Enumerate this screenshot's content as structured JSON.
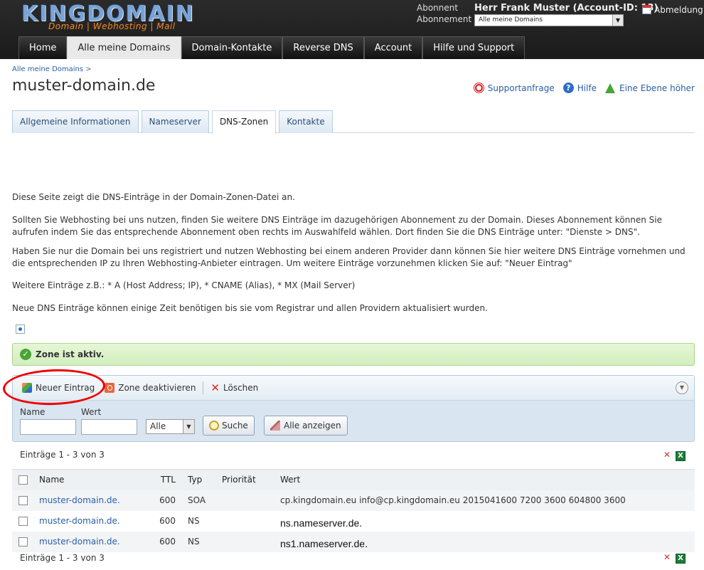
{
  "header": {
    "logo_text": "KINGDOMAIN",
    "logo_tagline": "Domain | Webhosting | Mail",
    "label_abonnent": "Abonnent",
    "label_abonnement": "Abonnement",
    "user": "Herr Frank Muster (Account-ID: 13)",
    "abonnement_selected": "Alle meine Domains",
    "logout": "Abmeldung"
  },
  "nav": [
    "Home",
    "Alle meine Domains",
    "Domain-Kontakte",
    "Reverse DNS",
    "Account",
    "Hilfe und Support"
  ],
  "breadcrumb": {
    "item": "Alle meine Domains",
    "sep": ">"
  },
  "page_title": "muster-domain.de",
  "top_actions": {
    "support": "Supportanfrage",
    "help": "Hilfe",
    "up": "Eine Ebene höher"
  },
  "tabs": [
    "Allgemeine Informationen",
    "Nameserver",
    "DNS-Zonen",
    "Kontakte"
  ],
  "paragraphs": [
    "Diese Seite zeigt die DNS-Einträge in der Domain-Zonen-Datei an.",
    "Sollten Sie Webhosting bei uns nutzen, finden Sie weitere DNS Einträge im dazugehörigen Abonnement zu der Domain. Dieses Abonnement können Sie aufrufen indem Sie das entsprechende Abonnement oben rechts im Auswahlfeld wählen. Dort finden Sie die DNS Einträge unter: \"Dienste > DNS\".",
    "Haben Sie nur die Domain bei uns registriert und nutzen Webhosting bei einem anderen Provider dann können Sie hier weitere DNS Einträge vornehmen und die entsprechenden IP zu Ihren Webhosting-Anbieter eintragen. Um weitere Einträge vorzunehmen klicken Sie auf: \"Neuer Eintrag\"",
    "Weitere Einträge z.B.: * A (Host Address; IP), * CNAME (Alias), * MX (Mail Server)",
    "Neue DNS Einträge können einige Zeit benötigen bis sie vom Registrar und allen Providern aktualisiert wurden."
  ],
  "status": "Zone ist aktiv.",
  "toolbar": {
    "new": "Neuer Eintrag",
    "deactivate": "Zone deaktivieren",
    "delete": "Löschen"
  },
  "filter": {
    "name_label": "Name",
    "wert_label": "Wert",
    "type_selected": "Alle",
    "search": "Suche",
    "show_all": "Alle anzeigen"
  },
  "count_text": "Einträge 1 - 3 von 3",
  "table": {
    "headers": {
      "name": "Name",
      "ttl": "TTL",
      "typ": "Typ",
      "prioritaet": "Priorität",
      "wert": "Wert"
    },
    "rows": [
      {
        "name": "muster-domain.de.",
        "ttl": "600",
        "typ": "SOA",
        "prioritaet": "",
        "wert": "cp.kingdomain.eu info@cp.kingdomain.eu 2015041600 7200 3600 604800 3600"
      },
      {
        "name": "muster-domain.de.",
        "ttl": "600",
        "typ": "NS",
        "prioritaet": "",
        "wert": "ns.nameserver.de."
      },
      {
        "name": "muster-domain.de.",
        "ttl": "600",
        "typ": "NS",
        "prioritaet": "",
        "wert": "ns1.nameserver.de."
      }
    ]
  }
}
